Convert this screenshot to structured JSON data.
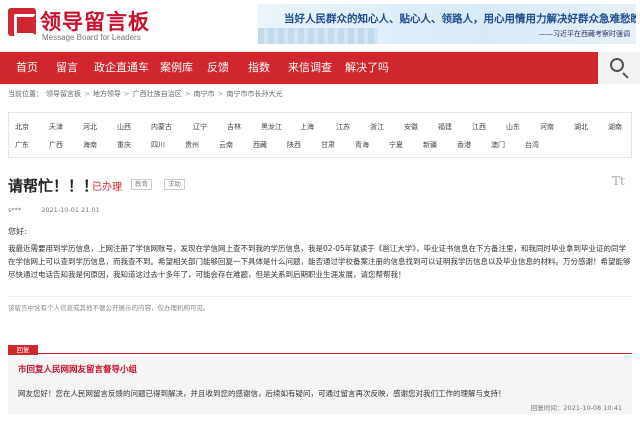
{
  "header": {
    "logo_title": "领导留言板",
    "logo_subtitle": "Message Board for Leaders",
    "banner_text": "当好人民群众的知心人、贴心人、领路人，用心用情用力解决好群众急难愁盼问题。",
    "banner_author": "——习近平在西藏考察时强调"
  },
  "nav": {
    "items": [
      "首页",
      "留言",
      "政企直通车",
      "案例库",
      "反馈",
      "指数",
      "来信调查",
      "解决了吗"
    ],
    "active_color": "#d0262d"
  },
  "breadcrumb": {
    "label": "当前位置：",
    "items": [
      "领导留言板",
      "地方领导",
      "广西壮族自治区",
      "南宁市",
      "南宁市市长孙大光"
    ]
  },
  "regions": {
    "row1": [
      "北京",
      "天津",
      "河北",
      "山西",
      "内蒙古",
      "辽宁",
      "吉林",
      "黑龙江",
      "上海",
      "江苏",
      "浙江",
      "安徽",
      "福建",
      "江西",
      "山东",
      "河南",
      "湖北",
      "湖南"
    ],
    "row2": [
      "广东",
      "广西",
      "海南",
      "重庆",
      "四川",
      "贵州",
      "云南",
      "西藏",
      "陕西",
      "甘肃",
      "青海",
      "宁夏",
      "新疆",
      "香港",
      "澳门",
      "台湾"
    ]
  },
  "message": {
    "title": "请帮忙！！！",
    "status": "已办理",
    "tags": [
      "教育",
      "求助"
    ],
    "font_toggle": "Tt",
    "author": "s***",
    "time": "2021-10-01 21:01",
    "greeting": "您好:",
    "body": "我最近需要用到学历信息，上网注册了学信网账号，发现在学信网上查不到我的学历信息，我是02-05年就读于《邕江大学》，毕业证书信息在下方备注里，和我同时毕业拿到毕业证的同学在学信网上可以查到学历信息，而我查不到。希望相关部门能够回复一下具体是什么问题，能否通过学校备案注册的信息找到可以证明我学历信息以及毕业信息的材料。万分感谢！希望能够尽快通过电话告知我是何原因，我知道这过去十多年了，可能会存在难题，但是关系到后期职业生涯发展，请您帮帮我！",
    "notice": "该留言中含有个人信息或其他不便公开展示的内容，仅办理机构可见。"
  },
  "reply": {
    "tab_label": "回复",
    "org": "市回复人民网网友留言督导小组",
    "text": "网友您好！您在人民网留言反馈的问题已得到解决，并且收到您的感谢信，后续如有疑问，可通过留言再次反映，感谢您对我们工作的理解与支持！",
    "time": "回复时间：2021-10-08 10:41"
  }
}
